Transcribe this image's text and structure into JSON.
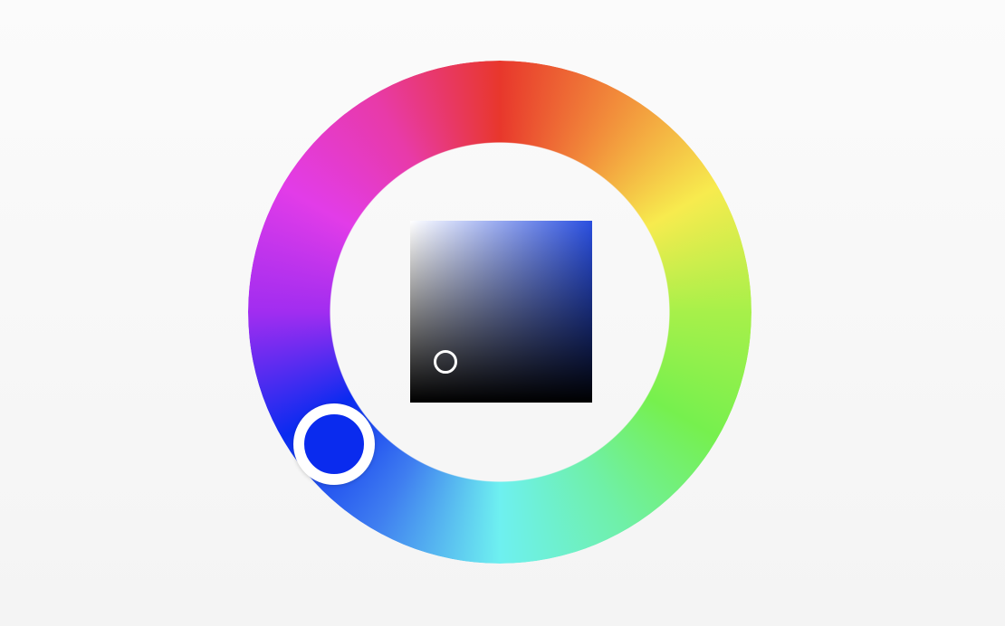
{
  "color_picker": {
    "hue_ring": {
      "hue_stops": [
        "#e8372c",
        "#f28f3b",
        "#f7eb4e",
        "#a7f04a",
        "#76f04e",
        "#6ff0a8",
        "#6ef0f0",
        "#3f7ef0",
        "#0a2bf0",
        "#a12df0",
        "#e23ce8",
        "#e83aa8",
        "#e8372c"
      ]
    },
    "hue_handle": {
      "color": "#0a2bee",
      "border_color": "#ffffff"
    },
    "sv_square": {
      "hue_color": "#2a4fe0",
      "white": "#ffffff",
      "black": "#000000"
    },
    "sv_handle": {
      "border_color": "#ffffff",
      "saturation": 0.2,
      "value": 0.22
    }
  }
}
